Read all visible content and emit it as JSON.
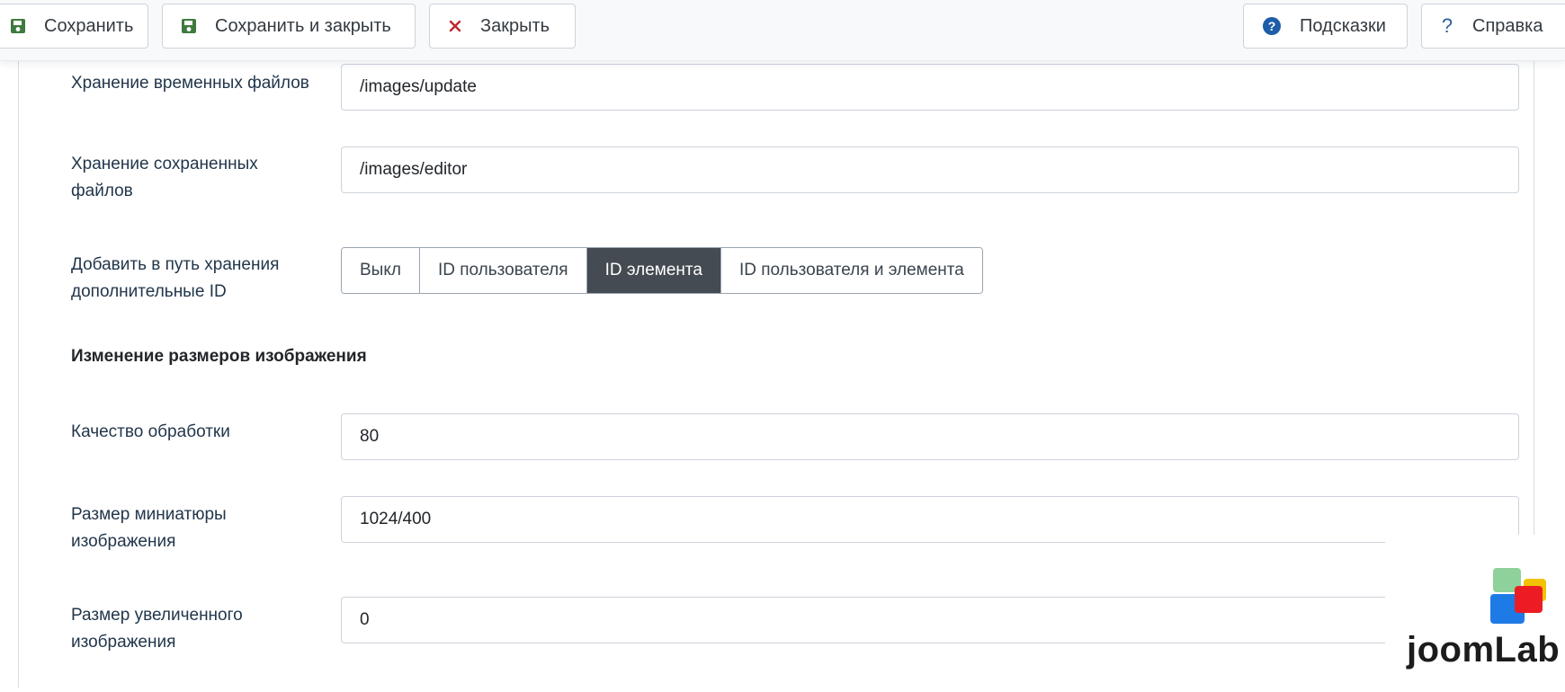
{
  "toolbar": {
    "save_label": "Сохранить",
    "save_close_label": "Сохранить и закрыть",
    "close_label": "Закрыть",
    "hints_label": "Подсказки",
    "help_label": "Справка"
  },
  "form": {
    "temp_storage": {
      "label": "Хранение временных файлов",
      "value": "/images/update"
    },
    "saved_storage": {
      "label_line1": "Хранение сохраненных",
      "label_line2": "файлов",
      "value": "/images/editor"
    },
    "extra_ids": {
      "label_line1": "Добавить в путь хранения",
      "label_line2": "дополнительные ID",
      "options": [
        "Выкл",
        "ID пользователя",
        "ID элемента",
        "ID пользователя и элемента"
      ],
      "selected": "ID элемента"
    },
    "section_title": "Изменение размеров изображения",
    "quality": {
      "label": "Качество обработки",
      "value": "80"
    },
    "thumb_size": {
      "label_line1": "Размер миниатюры",
      "label_line2": "изображения",
      "value": "1024/400"
    },
    "large_size": {
      "label_line1": "Размер увеличенного",
      "label_line2": "изображения",
      "value": "0"
    }
  },
  "logo": {
    "text": "joomLab"
  },
  "colors": {
    "save_icon": "#3f7a3e",
    "close_icon": "#c0282e",
    "hints_icon": "#1e5ea8",
    "help_icon": "#2c5f98",
    "active_segment": "#444b52"
  }
}
